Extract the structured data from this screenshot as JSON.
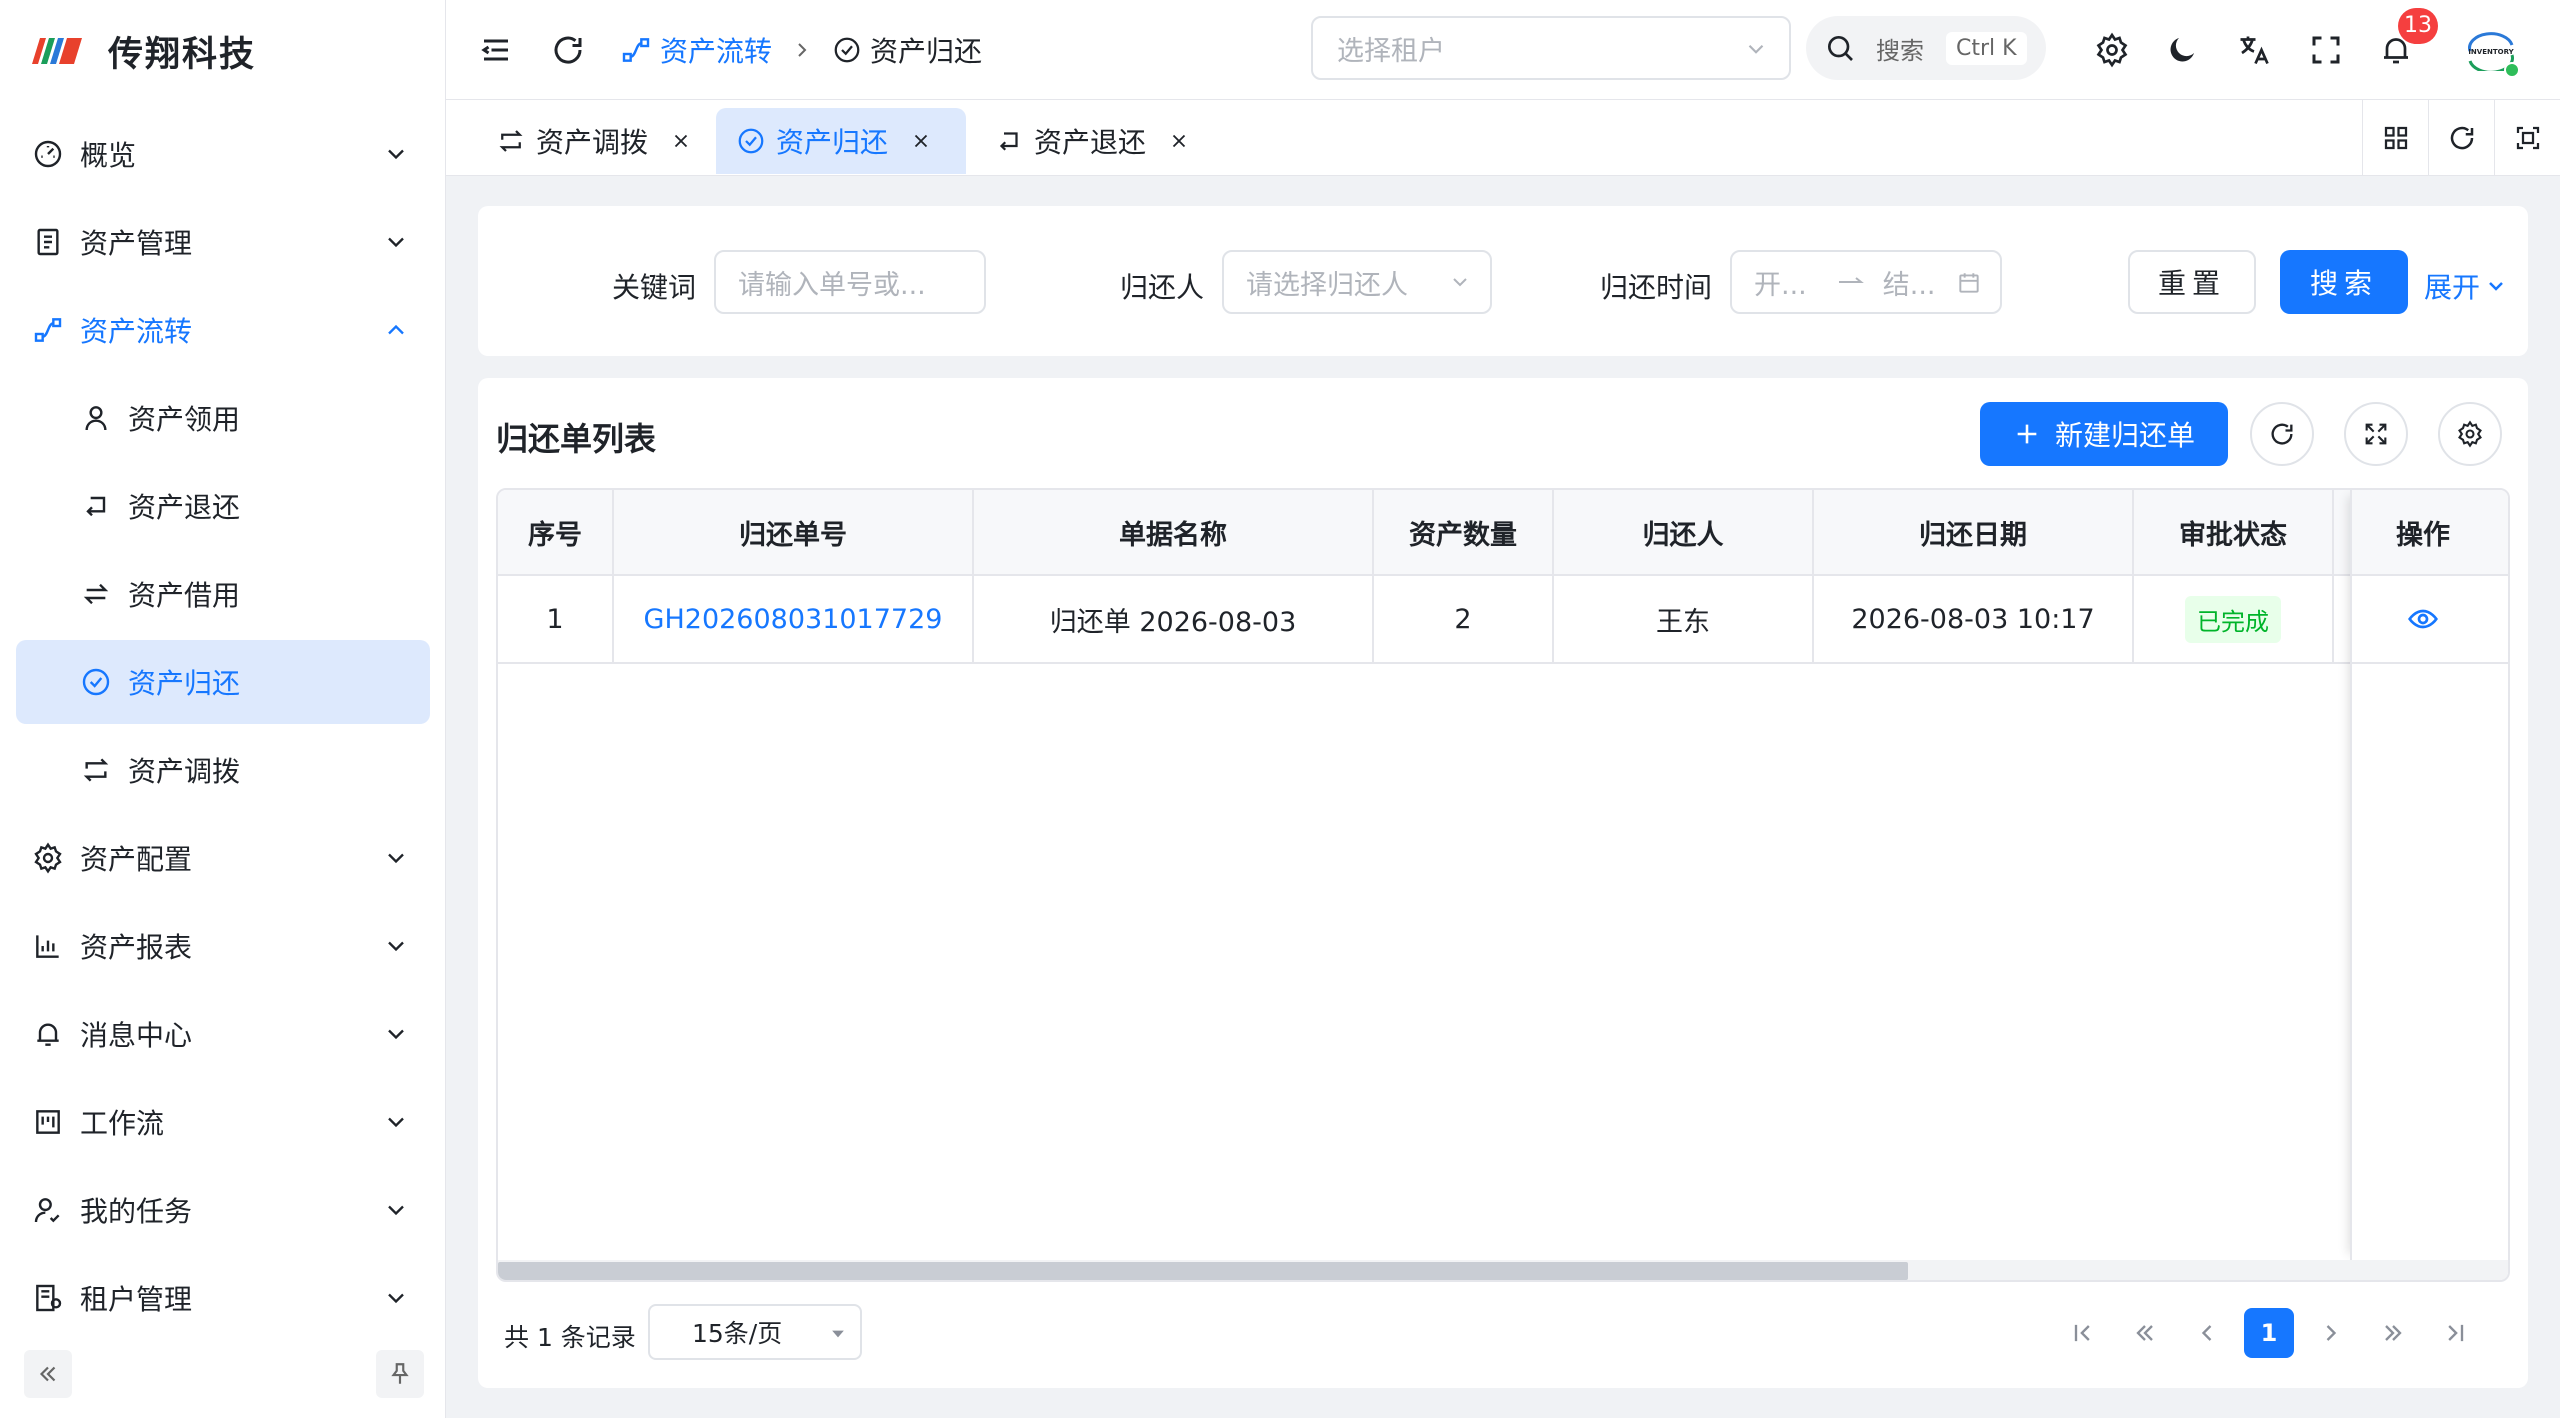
{
  "app": {
    "title": "传翔科技"
  },
  "sidebar": {
    "items": [
      {
        "label": "概览"
      },
      {
        "label": "资产管理"
      },
      {
        "label": "资产流转"
      },
      {
        "label": "资产领用"
      },
      {
        "label": "资产退还"
      },
      {
        "label": "资产借用"
      },
      {
        "label": "资产归还"
      },
      {
        "label": "资产调拨"
      },
      {
        "label": "资产配置"
      },
      {
        "label": "资产报表"
      },
      {
        "label": "消息中心"
      },
      {
        "label": "工作流"
      },
      {
        "label": "我的任务"
      },
      {
        "label": "租户管理"
      }
    ]
  },
  "header": {
    "breadcrumb": [
      {
        "label": "资产流转"
      },
      {
        "label": "资产归还"
      }
    ],
    "tenant_placeholder": "选择租户",
    "search_label": "搜索",
    "search_shortcut": "Ctrl K",
    "notification_count": "13",
    "avatar_text": "INVENTORY"
  },
  "tabs": [
    {
      "label": "资产调拨"
    },
    {
      "label": "资产归还"
    },
    {
      "label": "资产退还"
    }
  ],
  "filter": {
    "keyword_label": "关键词",
    "keyword_placeholder": "请输入单号或...",
    "returner_label": "归还人",
    "returner_placeholder": "请选择归还人",
    "time_label": "归还时间",
    "start_placeholder": "开...",
    "end_placeholder": "结...",
    "reset_label": "重置",
    "search_label": "搜索",
    "expand_label": "展开"
  },
  "table": {
    "title": "归还单列表",
    "new_button": "新建归还单",
    "columns": [
      "序号",
      "归还单号",
      "单据名称",
      "资产数量",
      "归还人",
      "归还日期",
      "审批状态",
      "操作"
    ],
    "rows": [
      {
        "index": "1",
        "number": "GH202608031017729",
        "name": "归还单 2026-08-03",
        "count": "2",
        "returner": "王东",
        "date": "2026-08-03 10:17",
        "status": "已完成"
      }
    ]
  },
  "pagination": {
    "total_text": "共 1 条记录",
    "page_size": "15条/页",
    "current_page": "1"
  },
  "colors": {
    "accent": "#1677ff",
    "active_bg": "#dde9fd",
    "success": "#00b42a",
    "danger": "#f53f3f"
  }
}
